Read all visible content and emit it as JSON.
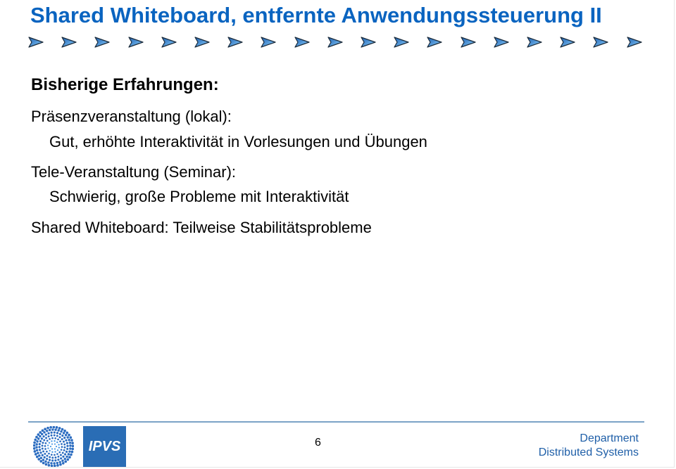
{
  "slide": {
    "title": "Shared Whiteboard, entfernte Anwendungssteuerung II",
    "decoration": {
      "icon": "arrow-bullet-icon",
      "count": 19,
      "color": "#4a90d9"
    },
    "heading": "Bisherige Erfahrungen:",
    "lines": [
      {
        "level": 1,
        "text": "Präsenzveranstaltung (lokal):"
      },
      {
        "level": 2,
        "text": "Gut, erhöhte Interaktivität in Vorlesungen und Übungen"
      },
      {
        "level": 1,
        "text": "Tele-Veranstaltung (Seminar):"
      },
      {
        "level": 2,
        "text": "Schwierig, große Probleme mit Interaktivität"
      },
      {
        "level": 1,
        "text": "Shared Whiteboard: Teilweise Stabilitätsprobleme"
      }
    ]
  },
  "footer": {
    "university_logo": "university-stuttgart-logo",
    "institute_logo_text": "IPVS",
    "page_number": "6",
    "department_line1": "Department",
    "department_line2": "Distributed Systems"
  },
  "colors": {
    "title": "#0a64c0",
    "footer_text": "#1f5fa8",
    "logo_blue": "#2a6db5",
    "rule": "#7ba3c6"
  }
}
